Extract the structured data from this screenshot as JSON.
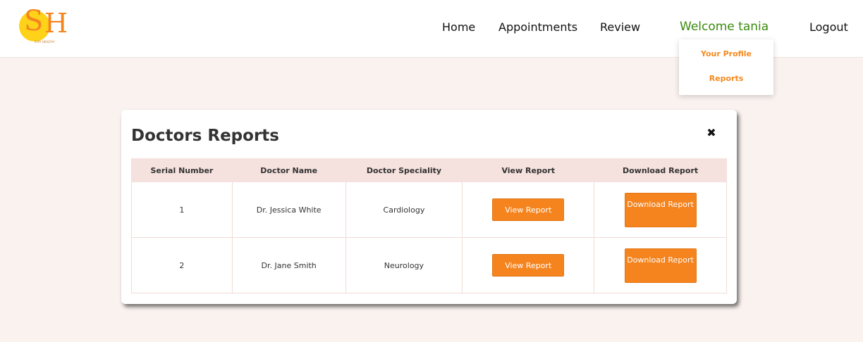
{
  "brand": {
    "logo_letters": [
      "S",
      "H"
    ],
    "tagline": "STAY HEALTHY",
    "colors": {
      "orange": "#f5841f",
      "yellow": "#ffd21a",
      "green": "#3a8a0e"
    }
  },
  "nav": {
    "home": "Home",
    "appointments": "Appointments",
    "review": "Review",
    "welcome": "Welcome tania",
    "logout": "Logout"
  },
  "dropdown": {
    "profile": "Your Profile",
    "reports": "Reports"
  },
  "modal": {
    "title": "Doctors Reports",
    "close_icon": "close-icon",
    "columns": [
      "Serial Number",
      "Doctor Name",
      "Doctor Speciality",
      "View Report",
      "Download Report"
    ],
    "rows": [
      {
        "serial": "1",
        "doctor": "Dr. Jessica White",
        "speciality": "Cardiology",
        "view": "View Report",
        "download": "Download Report"
      },
      {
        "serial": "2",
        "doctor": "Dr. Jane Smith",
        "speciality": "Neurology",
        "view": "View Report",
        "download": "Download Report"
      }
    ]
  }
}
